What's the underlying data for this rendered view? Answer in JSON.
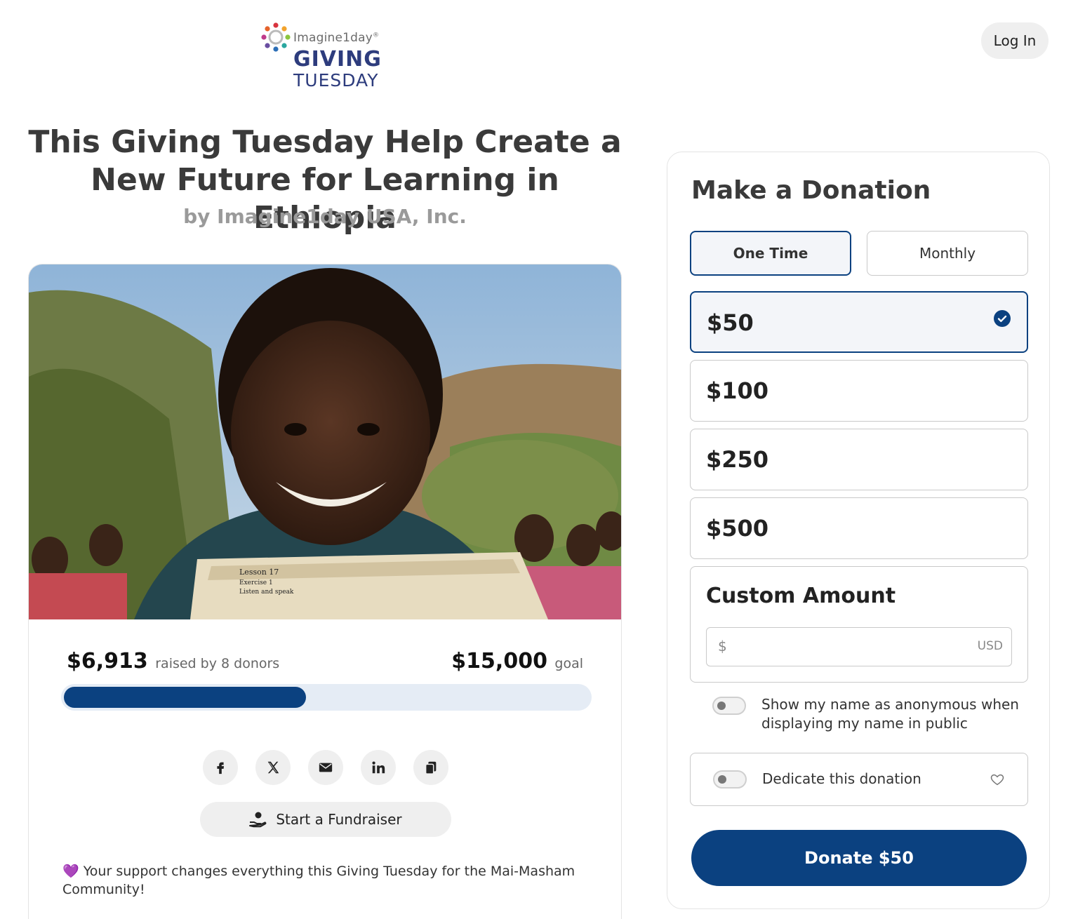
{
  "header": {
    "logo_org": "Imagine1day",
    "logo_giving": "GIVING",
    "logo_tuesday": "TUESDAY",
    "login_label": "Log In"
  },
  "campaign": {
    "title": "This Giving Tuesday Help Create a New Future for Learning in Ethiopia",
    "byline": "by Imagine1day USA, Inc.",
    "raised_amount": "$6,913",
    "raised_text": "raised by 8 donors",
    "goal_amount": "$15,000",
    "goal_text": "goal",
    "progress_fraction": 0.461,
    "share_icons": [
      "facebook-icon",
      "x-icon",
      "email-icon",
      "linkedin-icon",
      "copy-link-icon"
    ],
    "fundraiser_label": "Start a Fundraiser",
    "message_emoji": "💜",
    "message": "Your support changes everything this Giving Tuesday for the Mai-Masham Community!",
    "photo_book_text": [
      "Lesson 17",
      "Exercise 1",
      "Listen and speak"
    ]
  },
  "donation": {
    "title": "Make a Donation",
    "frequency": [
      {
        "label": "One Time",
        "active": true
      },
      {
        "label": "Monthly",
        "active": false
      }
    ],
    "amounts": [
      {
        "label": "$50",
        "selected": true
      },
      {
        "label": "$100",
        "selected": false
      },
      {
        "label": "$250",
        "selected": false
      },
      {
        "label": "$500",
        "selected": false
      }
    ],
    "custom_title": "Custom Amount",
    "currency_symbol": "$",
    "currency_code": "USD",
    "custom_value": "",
    "anonymous_label": "Show my name as anonymous when displaying my name in public",
    "anonymous_on": false,
    "dedicate_label": "Dedicate this donation",
    "dedicate_on": false,
    "donate_label": "Donate $50"
  },
  "colors": {
    "primary": "#0b4180",
    "progress_track": "#e5ecf5",
    "logo_blue": "#2d3c7d",
    "heart_red": "#d8343f"
  }
}
